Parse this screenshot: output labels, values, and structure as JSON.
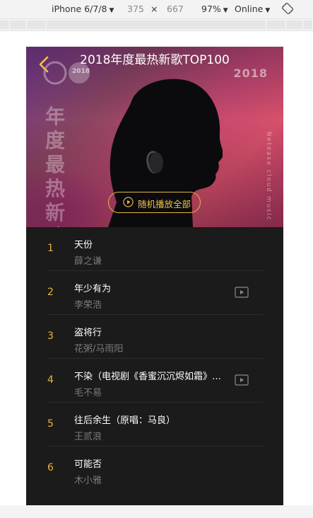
{
  "devtools": {
    "device": "iPhone 6/7/8",
    "width": "375",
    "times": "×",
    "height": "667",
    "zoom": "97%",
    "network": "Online",
    "caret": "▼",
    "rotate_icon": "rotate-icon"
  },
  "header": {
    "title": "2018年度最热新歌TOP100",
    "back_icon": "chevron-left-icon"
  },
  "hero": {
    "year": "2018",
    "logo_year": "2018",
    "vertical_text": "年度最热新歌",
    "side_text": "Netease cloud music"
  },
  "play_all": {
    "label": "随机播放全部",
    "icon": "play-circle-icon"
  },
  "songs": [
    {
      "rank": "1",
      "name": "天份",
      "artist": "薛之谦",
      "has_mv": false
    },
    {
      "rank": "2",
      "name": "年少有为",
      "artist": "李荣浩",
      "has_mv": true
    },
    {
      "rank": "3",
      "name": "盗将行",
      "artist": "花粥/马雨阳",
      "has_mv": false
    },
    {
      "rank": "4",
      "name": "不染（电视剧《香蜜沉沉烬如霜》片尾曲）",
      "artist": "毛不易",
      "has_mv": true
    },
    {
      "rank": "5",
      "name": "往后余生（原唱：马良）",
      "artist": "王贰浪",
      "has_mv": false
    },
    {
      "rank": "6",
      "name": "可能否",
      "artist": "木小雅",
      "has_mv": false
    }
  ],
  "colors": {
    "accent": "#f1c14a",
    "list_bg": "#1b1b1b",
    "artist_text": "#7a7a7a"
  }
}
